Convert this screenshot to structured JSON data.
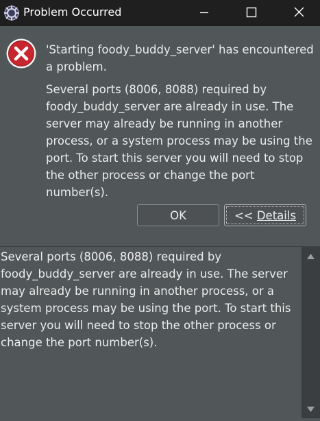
{
  "window": {
    "title": "Problem Occurred",
    "controls": {
      "minimize": "minimize",
      "maximize": "maximize",
      "close": "close"
    }
  },
  "message": {
    "title": "'Starting foody_buddy_server' has encountered a problem.",
    "detail": "Several ports (8006, 8088) required by foody_buddy_server are already in use. The server may already be running in another process, or a system process may be using the port. To start this server you will need to stop the other process or change the port number(s).",
    "icon": "error-icon"
  },
  "buttons": {
    "ok_label": "OK",
    "details_prefix": "<< ",
    "details_label": "Details"
  },
  "details": {
    "text": "Several ports (8006, 8088) required by foody_buddy_server are already in use. The server may already be running in another process, or a system process may be using the port. To start this server you will need to stop the other process or change the port number(s)."
  },
  "colors": {
    "titlebar": "#1f1f1f",
    "background": "#515658",
    "error_red": "#c8262e",
    "scrollbar": "#3a3e40"
  }
}
